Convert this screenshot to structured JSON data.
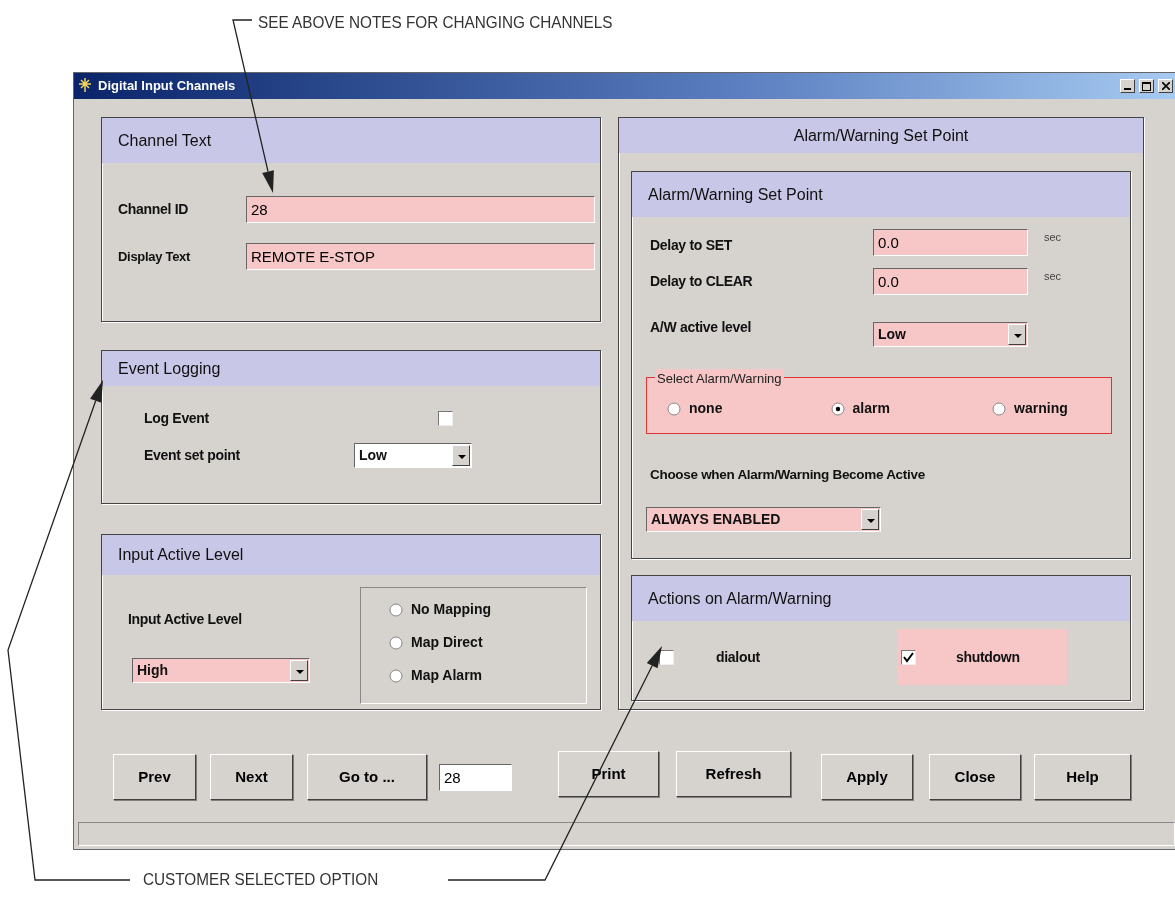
{
  "annotations": [
    {
      "text": "SEE ABOVE NOTES FOR CHANGING CHANNELS"
    },
    {
      "text": "CUSTOMER SELECTED OPTION"
    }
  ],
  "window": {
    "title": "Digital Input Channels"
  },
  "channel_text": {
    "title": "Channel Text",
    "fields": [
      {
        "label": "Channel ID",
        "value": "28",
        "highlighted": true
      },
      {
        "label": "Display Text",
        "value": "REMOTE E-STOP",
        "highlighted": true
      }
    ]
  },
  "event_logging": {
    "title": "Event Logging",
    "log_event": {
      "label": "Log Event",
      "checked": false
    },
    "set_point": {
      "label": "Event set point",
      "value": "Low",
      "highlighted": false
    }
  },
  "input_active_level": {
    "title": "Input Active Level",
    "label": "Input Active Level",
    "select": {
      "value": "High",
      "highlighted": true
    },
    "mapping": [
      {
        "label": "No Mapping",
        "selected": false
      },
      {
        "label": "Map Direct",
        "selected": false
      },
      {
        "label": "Map Alarm",
        "selected": false
      }
    ]
  },
  "alarm_warning": {
    "title": "Alarm/Warning Set Point",
    "inner_title": "Alarm/Warning Set Point",
    "delays": [
      {
        "label": "Delay to SET",
        "value": "0.0",
        "unit": "sec",
        "highlighted": true
      },
      {
        "label": "Delay to CLEAR",
        "value": "0.0",
        "unit": "sec",
        "highlighted": true
      }
    ],
    "active_level": {
      "label": "A/W active level",
      "value": "Low",
      "highlighted": true
    },
    "select": {
      "legend": "Select Alarm/Warning",
      "options": [
        {
          "label": "none",
          "selected": false
        },
        {
          "label": "alarm",
          "selected": true
        },
        {
          "label": "warning",
          "selected": false
        }
      ]
    },
    "when": {
      "label": "Choose when Alarm/Warning Become Active",
      "value": "ALWAYS ENABLED",
      "highlighted": true
    }
  },
  "actions": {
    "title": "Actions on Alarm/Warning",
    "items": [
      {
        "label": "dialout",
        "checked": false
      },
      {
        "label": "shutdown",
        "checked": true
      }
    ]
  },
  "nav_buttons": [
    "Prev",
    "Next",
    "Go to ..."
  ],
  "goto_value": "28",
  "buttons": [
    "Print",
    "Refresh",
    "Apply",
    "Close",
    "Help"
  ]
}
